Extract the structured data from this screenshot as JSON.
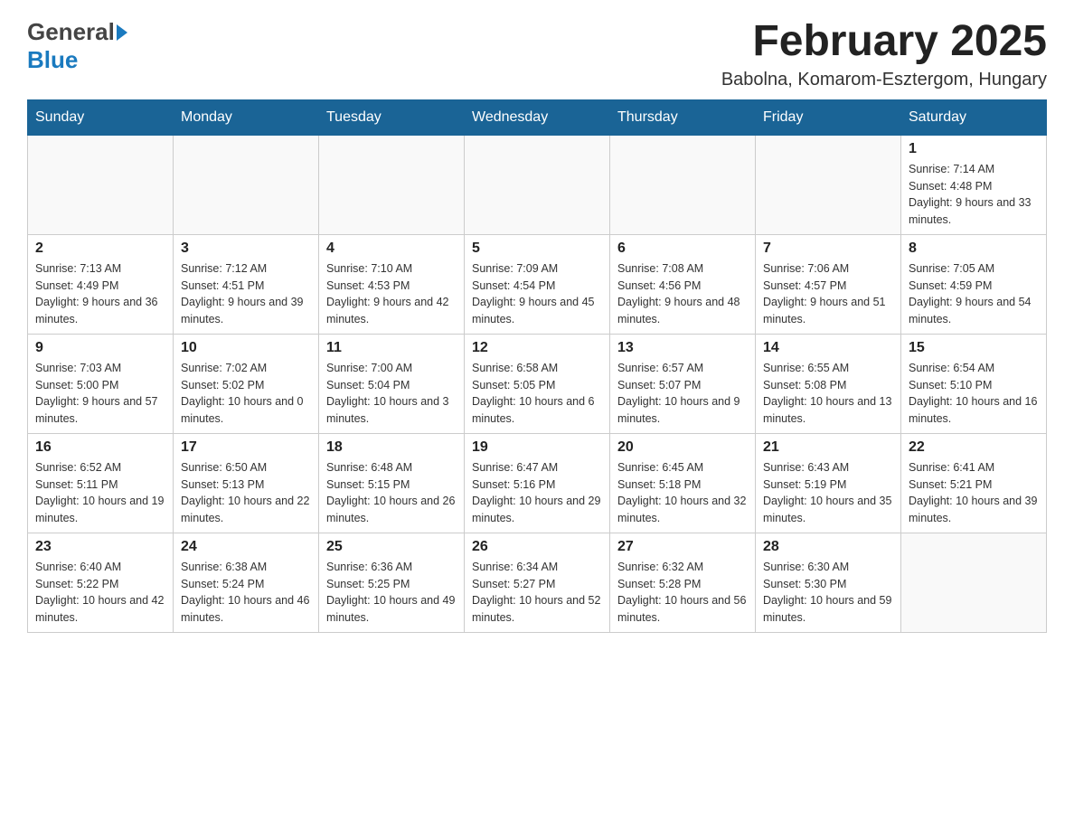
{
  "header": {
    "logo_general": "General",
    "logo_blue": "Blue",
    "month_title": "February 2025",
    "location": "Babolna, Komarom-Esztergom, Hungary"
  },
  "days_of_week": [
    "Sunday",
    "Monday",
    "Tuesday",
    "Wednesday",
    "Thursday",
    "Friday",
    "Saturday"
  ],
  "weeks": [
    {
      "days": [
        {
          "number": "",
          "info": ""
        },
        {
          "number": "",
          "info": ""
        },
        {
          "number": "",
          "info": ""
        },
        {
          "number": "",
          "info": ""
        },
        {
          "number": "",
          "info": ""
        },
        {
          "number": "",
          "info": ""
        },
        {
          "number": "1",
          "info": "Sunrise: 7:14 AM\nSunset: 4:48 PM\nDaylight: 9 hours and 33 minutes."
        }
      ]
    },
    {
      "days": [
        {
          "number": "2",
          "info": "Sunrise: 7:13 AM\nSunset: 4:49 PM\nDaylight: 9 hours and 36 minutes."
        },
        {
          "number": "3",
          "info": "Sunrise: 7:12 AM\nSunset: 4:51 PM\nDaylight: 9 hours and 39 minutes."
        },
        {
          "number": "4",
          "info": "Sunrise: 7:10 AM\nSunset: 4:53 PM\nDaylight: 9 hours and 42 minutes."
        },
        {
          "number": "5",
          "info": "Sunrise: 7:09 AM\nSunset: 4:54 PM\nDaylight: 9 hours and 45 minutes."
        },
        {
          "number": "6",
          "info": "Sunrise: 7:08 AM\nSunset: 4:56 PM\nDaylight: 9 hours and 48 minutes."
        },
        {
          "number": "7",
          "info": "Sunrise: 7:06 AM\nSunset: 4:57 PM\nDaylight: 9 hours and 51 minutes."
        },
        {
          "number": "8",
          "info": "Sunrise: 7:05 AM\nSunset: 4:59 PM\nDaylight: 9 hours and 54 minutes."
        }
      ]
    },
    {
      "days": [
        {
          "number": "9",
          "info": "Sunrise: 7:03 AM\nSunset: 5:00 PM\nDaylight: 9 hours and 57 minutes."
        },
        {
          "number": "10",
          "info": "Sunrise: 7:02 AM\nSunset: 5:02 PM\nDaylight: 10 hours and 0 minutes."
        },
        {
          "number": "11",
          "info": "Sunrise: 7:00 AM\nSunset: 5:04 PM\nDaylight: 10 hours and 3 minutes."
        },
        {
          "number": "12",
          "info": "Sunrise: 6:58 AM\nSunset: 5:05 PM\nDaylight: 10 hours and 6 minutes."
        },
        {
          "number": "13",
          "info": "Sunrise: 6:57 AM\nSunset: 5:07 PM\nDaylight: 10 hours and 9 minutes."
        },
        {
          "number": "14",
          "info": "Sunrise: 6:55 AM\nSunset: 5:08 PM\nDaylight: 10 hours and 13 minutes."
        },
        {
          "number": "15",
          "info": "Sunrise: 6:54 AM\nSunset: 5:10 PM\nDaylight: 10 hours and 16 minutes."
        }
      ]
    },
    {
      "days": [
        {
          "number": "16",
          "info": "Sunrise: 6:52 AM\nSunset: 5:11 PM\nDaylight: 10 hours and 19 minutes."
        },
        {
          "number": "17",
          "info": "Sunrise: 6:50 AM\nSunset: 5:13 PM\nDaylight: 10 hours and 22 minutes."
        },
        {
          "number": "18",
          "info": "Sunrise: 6:48 AM\nSunset: 5:15 PM\nDaylight: 10 hours and 26 minutes."
        },
        {
          "number": "19",
          "info": "Sunrise: 6:47 AM\nSunset: 5:16 PM\nDaylight: 10 hours and 29 minutes."
        },
        {
          "number": "20",
          "info": "Sunrise: 6:45 AM\nSunset: 5:18 PM\nDaylight: 10 hours and 32 minutes."
        },
        {
          "number": "21",
          "info": "Sunrise: 6:43 AM\nSunset: 5:19 PM\nDaylight: 10 hours and 35 minutes."
        },
        {
          "number": "22",
          "info": "Sunrise: 6:41 AM\nSunset: 5:21 PM\nDaylight: 10 hours and 39 minutes."
        }
      ]
    },
    {
      "days": [
        {
          "number": "23",
          "info": "Sunrise: 6:40 AM\nSunset: 5:22 PM\nDaylight: 10 hours and 42 minutes."
        },
        {
          "number": "24",
          "info": "Sunrise: 6:38 AM\nSunset: 5:24 PM\nDaylight: 10 hours and 46 minutes."
        },
        {
          "number": "25",
          "info": "Sunrise: 6:36 AM\nSunset: 5:25 PM\nDaylight: 10 hours and 49 minutes."
        },
        {
          "number": "26",
          "info": "Sunrise: 6:34 AM\nSunset: 5:27 PM\nDaylight: 10 hours and 52 minutes."
        },
        {
          "number": "27",
          "info": "Sunrise: 6:32 AM\nSunset: 5:28 PM\nDaylight: 10 hours and 56 minutes."
        },
        {
          "number": "28",
          "info": "Sunrise: 6:30 AM\nSunset: 5:30 PM\nDaylight: 10 hours and 59 minutes."
        },
        {
          "number": "",
          "info": ""
        }
      ]
    }
  ]
}
